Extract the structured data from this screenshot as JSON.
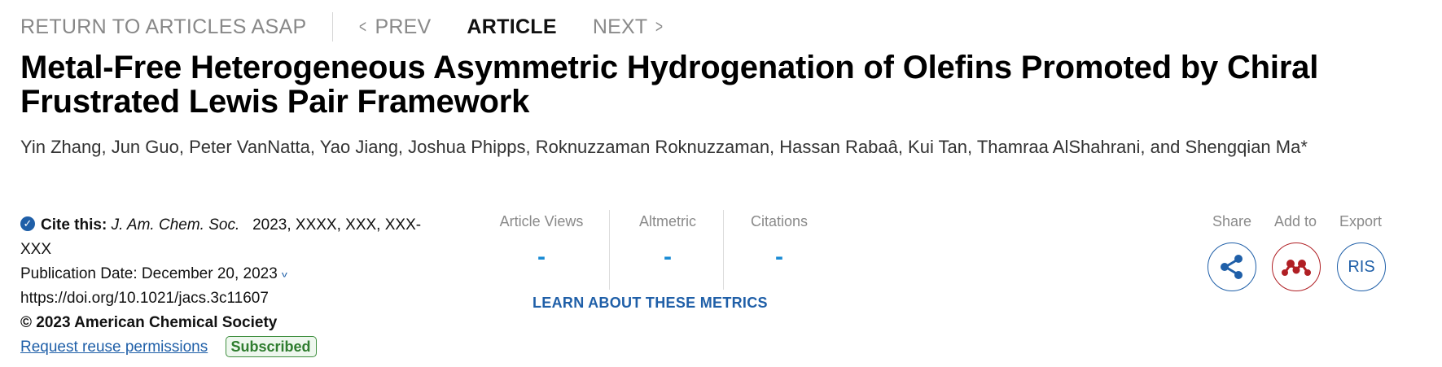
{
  "nav": {
    "return_label": "RETURN TO ARTICLES ASAP",
    "prev_label": "PREV",
    "article_label": "ARTICLE",
    "next_label": "NEXT"
  },
  "article": {
    "title": "Metal-Free Heterogeneous Asymmetric Hydrogenation of Olefins Promoted by Chiral Frustrated Lewis Pair Framework",
    "authors": "Yin Zhang, Jun Guo, Peter VanNatta, Yao Jiang, Joshua Phipps, Roknuzzaman Roknuzzaman, Hassan Rabaâ, Kui Tan, Thamraa AlShahrani, and Shengqian Ma*"
  },
  "cite": {
    "label": "Cite this:",
    "journal": "J. Am. Chem. Soc.",
    "details": "2023, XXXX, XXX, XXX-",
    "details_cont": "XXX",
    "pub_date": "Publication Date: December 20, 2023",
    "doi": "https://doi.org/10.1021/jacs.3c11607",
    "copyright": "© 2023 American Chemical Society",
    "reuse_link": "Request reuse permissions",
    "badge": "Subscribed"
  },
  "metrics": {
    "items": [
      {
        "label": "Article Views",
        "value": "-"
      },
      {
        "label": "Altmetric",
        "value": "-"
      },
      {
        "label": "Citations",
        "value": "-"
      }
    ],
    "learn_label": "LEARN ABOUT THESE METRICS"
  },
  "tools": {
    "share_label": "Share",
    "addto_label": "Add to",
    "export_label": "Export",
    "ris_label": "RIS"
  },
  "icons": {
    "share": "share-icon",
    "addto": "mendeley-icon",
    "check": "check-circle-icon"
  },
  "colors": {
    "link_blue": "#1f5fa8",
    "metric_blue": "#1a8bd4",
    "subscribed_green": "#2f7d2f",
    "addto_red": "#b01f24"
  }
}
